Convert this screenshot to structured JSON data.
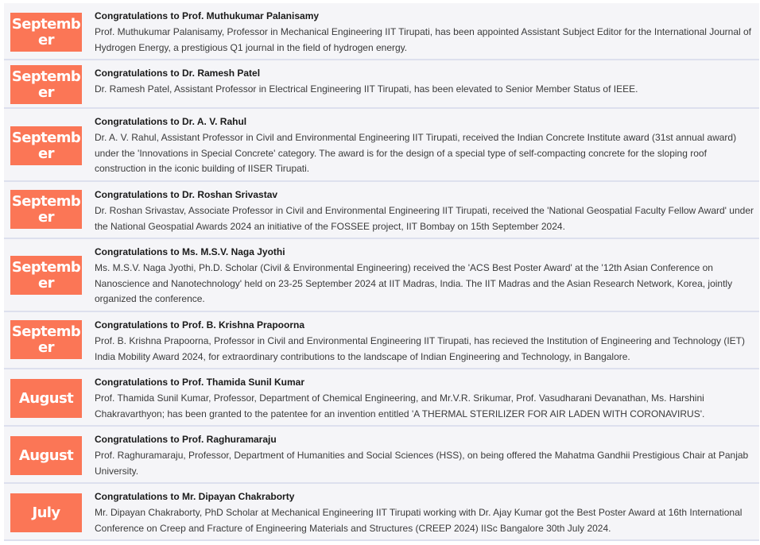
{
  "news": [
    {
      "month": "September",
      "title": "Congratulations to Prof. Muthukumar Palanisamy",
      "body": "Prof. Muthukumar Palanisamy, Professor in Mechanical Engineering IIT Tirupati, has been appointed Assistant Subject Editor for the International Journal of Hydrogen Energy, a prestigious Q1 journal in the field of hydrogen energy."
    },
    {
      "month": "September",
      "title": "Congratulations to Dr. Ramesh Patel",
      "body": "Dr. Ramesh Patel, Assistant Professor in Electrical Engineering IIT Tirupati, has been elevated to Senior Member Status of IEEE."
    },
    {
      "month": "September",
      "title": "Congratulations to Dr. A. V. Rahul",
      "body": "Dr. A. V. Rahul, Assistant Professor in Civil and Environmental Engineering IIT Tirupati, received the Indian Concrete Institute award (31st annual award) under the 'Innovations in Special Concrete' category. The award is for the design of a special type of self-compacting concrete for the sloping roof construction in the iconic building of IISER Tirupati."
    },
    {
      "month": "September",
      "title": "Congratulations to Dr. Roshan Srivastav",
      "body": "Dr. Roshan Srivastav, Associate Professor in Civil and Environmental Engineering IIT Tirupati, received the 'National Geospatial Faculty Fellow Award' under the National Geospatial Awards 2024 an initiative of the FOSSEE project, IIT Bombay on 15th September 2024."
    },
    {
      "month": "September",
      "title": "Congratulations to Ms. M.S.V. Naga Jyothi",
      "body": "Ms. M.S.V. Naga Jyothi, Ph.D. Scholar (Civil & Environmental Engineering) received the 'ACS Best Poster Award' at the '12th Asian Conference on Nanoscience and Nanotechnology' held on 23-25 September 2024 at IIT Madras, India. The IIT Madras and the Asian Research Network, Korea, jointly organized the conference."
    },
    {
      "month": "September",
      "title": "Congratulations to Prof. B. Krishna Prapoorna",
      "body": "Prof. B. Krishna Prapoorna, Professor in Civil and Environmental Engineering IIT Tirupati, has recieved the Institution of Engineering and Technology (IET) India Mobility Award 2024, for extraordinary contributions to the landscape of Indian Engineering and Technology, in Bangalore."
    },
    {
      "month": "August",
      "title": "Congratulations to Prof. Thamida Sunil Kumar",
      "body": "Prof. Thamida Sunil Kumar, Professor, Department of Chemical Engineering, and Mr.V.R. Srikumar, Prof. Vasudharani Devanathan, Ms. Harshini Chakravarthyon; has been granted to the patentee for an invention entitled 'A THERMAL STERILIZER FOR AIR LADEN WITH CORONAVIRUS'."
    },
    {
      "month": "August",
      "title": "Congratulations to Prof. Raghuramaraju",
      "body": "Prof. Raghuramaraju, Professor, Department of Humanities and Social Sciences (HSS), on being offered the Mahatma Gandhii Prestigious Chair at Panjab University."
    },
    {
      "month": "July",
      "title": "Congratulations to Mr. Dipayan Chakraborty",
      "body": "Mr. Dipayan Chakraborty, PhD Scholar at Mechanical Engineering IIT Tirupati working with Dr. Ajay Kumar got the Best Poster Award at 16th International Conference on Creep and Fracture of Engineering Materials and Structures (CREEP 2024) IISc Bangalore 30th July 2024."
    }
  ],
  "colors": {
    "badge": "#fb7656",
    "row_background": "#f5f5f8",
    "row_border": "#dde0ee"
  }
}
